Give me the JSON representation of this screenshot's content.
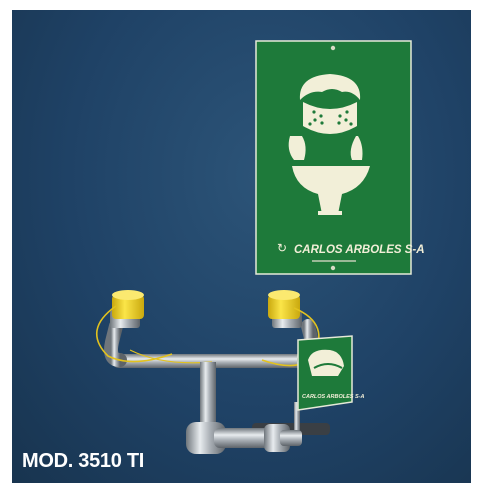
{
  "caption": "MOD. 3510 TI",
  "wall_sign": {
    "brand": "CARLOS ARBOLES S-A"
  },
  "small_sign": {
    "brand": "CARLOS ARBOLES S-A"
  },
  "colors": {
    "wall": "#1f4266",
    "sign_green": "#1e7a3a",
    "pictogram": "#f2efd8",
    "nozzle_cap": "#f4d21c",
    "steel": "#b9bec3"
  }
}
